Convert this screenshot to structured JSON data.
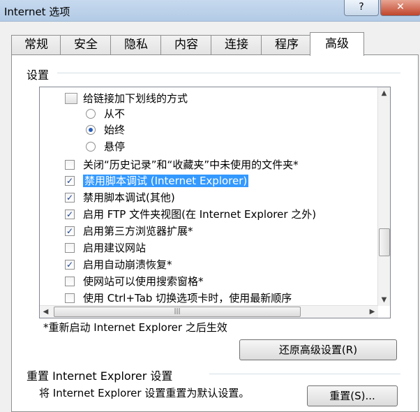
{
  "window": {
    "title": "Internet 选项",
    "help_label": "?",
    "close_label": "✕"
  },
  "tabs": [
    {
      "label": "常规"
    },
    {
      "label": "安全"
    },
    {
      "label": "隐私"
    },
    {
      "label": "内容"
    },
    {
      "label": "连接"
    },
    {
      "label": "程序"
    },
    {
      "label": "高级",
      "active": true
    }
  ],
  "settings": {
    "group_label": "设置",
    "items": [
      {
        "label": "给链接加下划线的方式",
        "kind": "group-header"
      },
      {
        "label": "从不",
        "kind": "radio",
        "selected": false
      },
      {
        "label": "始终",
        "kind": "radio",
        "selected": true
      },
      {
        "label": "悬停",
        "kind": "radio",
        "selected": false
      },
      {
        "label": "关闭“历史记录”和“收藏夹”中未使用的文件夹*",
        "kind": "checkbox",
        "checked": false
      },
      {
        "label": "禁用脚本调试 (Internet Explorer)",
        "kind": "checkbox",
        "checked": true,
        "highlighted": true
      },
      {
        "label": "禁用脚本调试(其他)",
        "kind": "checkbox",
        "checked": true
      },
      {
        "label": "启用 FTP 文件夹视图(在 Internet Explorer 之外)",
        "kind": "checkbox",
        "checked": true
      },
      {
        "label": "启用第三方浏览器扩展*",
        "kind": "checkbox",
        "checked": true
      },
      {
        "label": "启用建议网站",
        "kind": "checkbox",
        "checked": false
      },
      {
        "label": "启用自动崩溃恢复*",
        "kind": "checkbox",
        "checked": true
      },
      {
        "label": "使网站可以使用搜索窗格*",
        "kind": "checkbox",
        "checked": false
      },
      {
        "label": "使用 Ctrl+Tab 切换选项卡时，使用最新顺序",
        "kind": "checkbox",
        "checked": false
      }
    ],
    "restart_note": "*重新启动 Internet Explorer 之后生效",
    "restore_button": "还原高级设置(R)"
  },
  "reset": {
    "group_label": "重置 Internet Explorer 设置",
    "description": "将 Internet Explorer 设置重置为默认设置。",
    "button": "重置(S)..."
  }
}
